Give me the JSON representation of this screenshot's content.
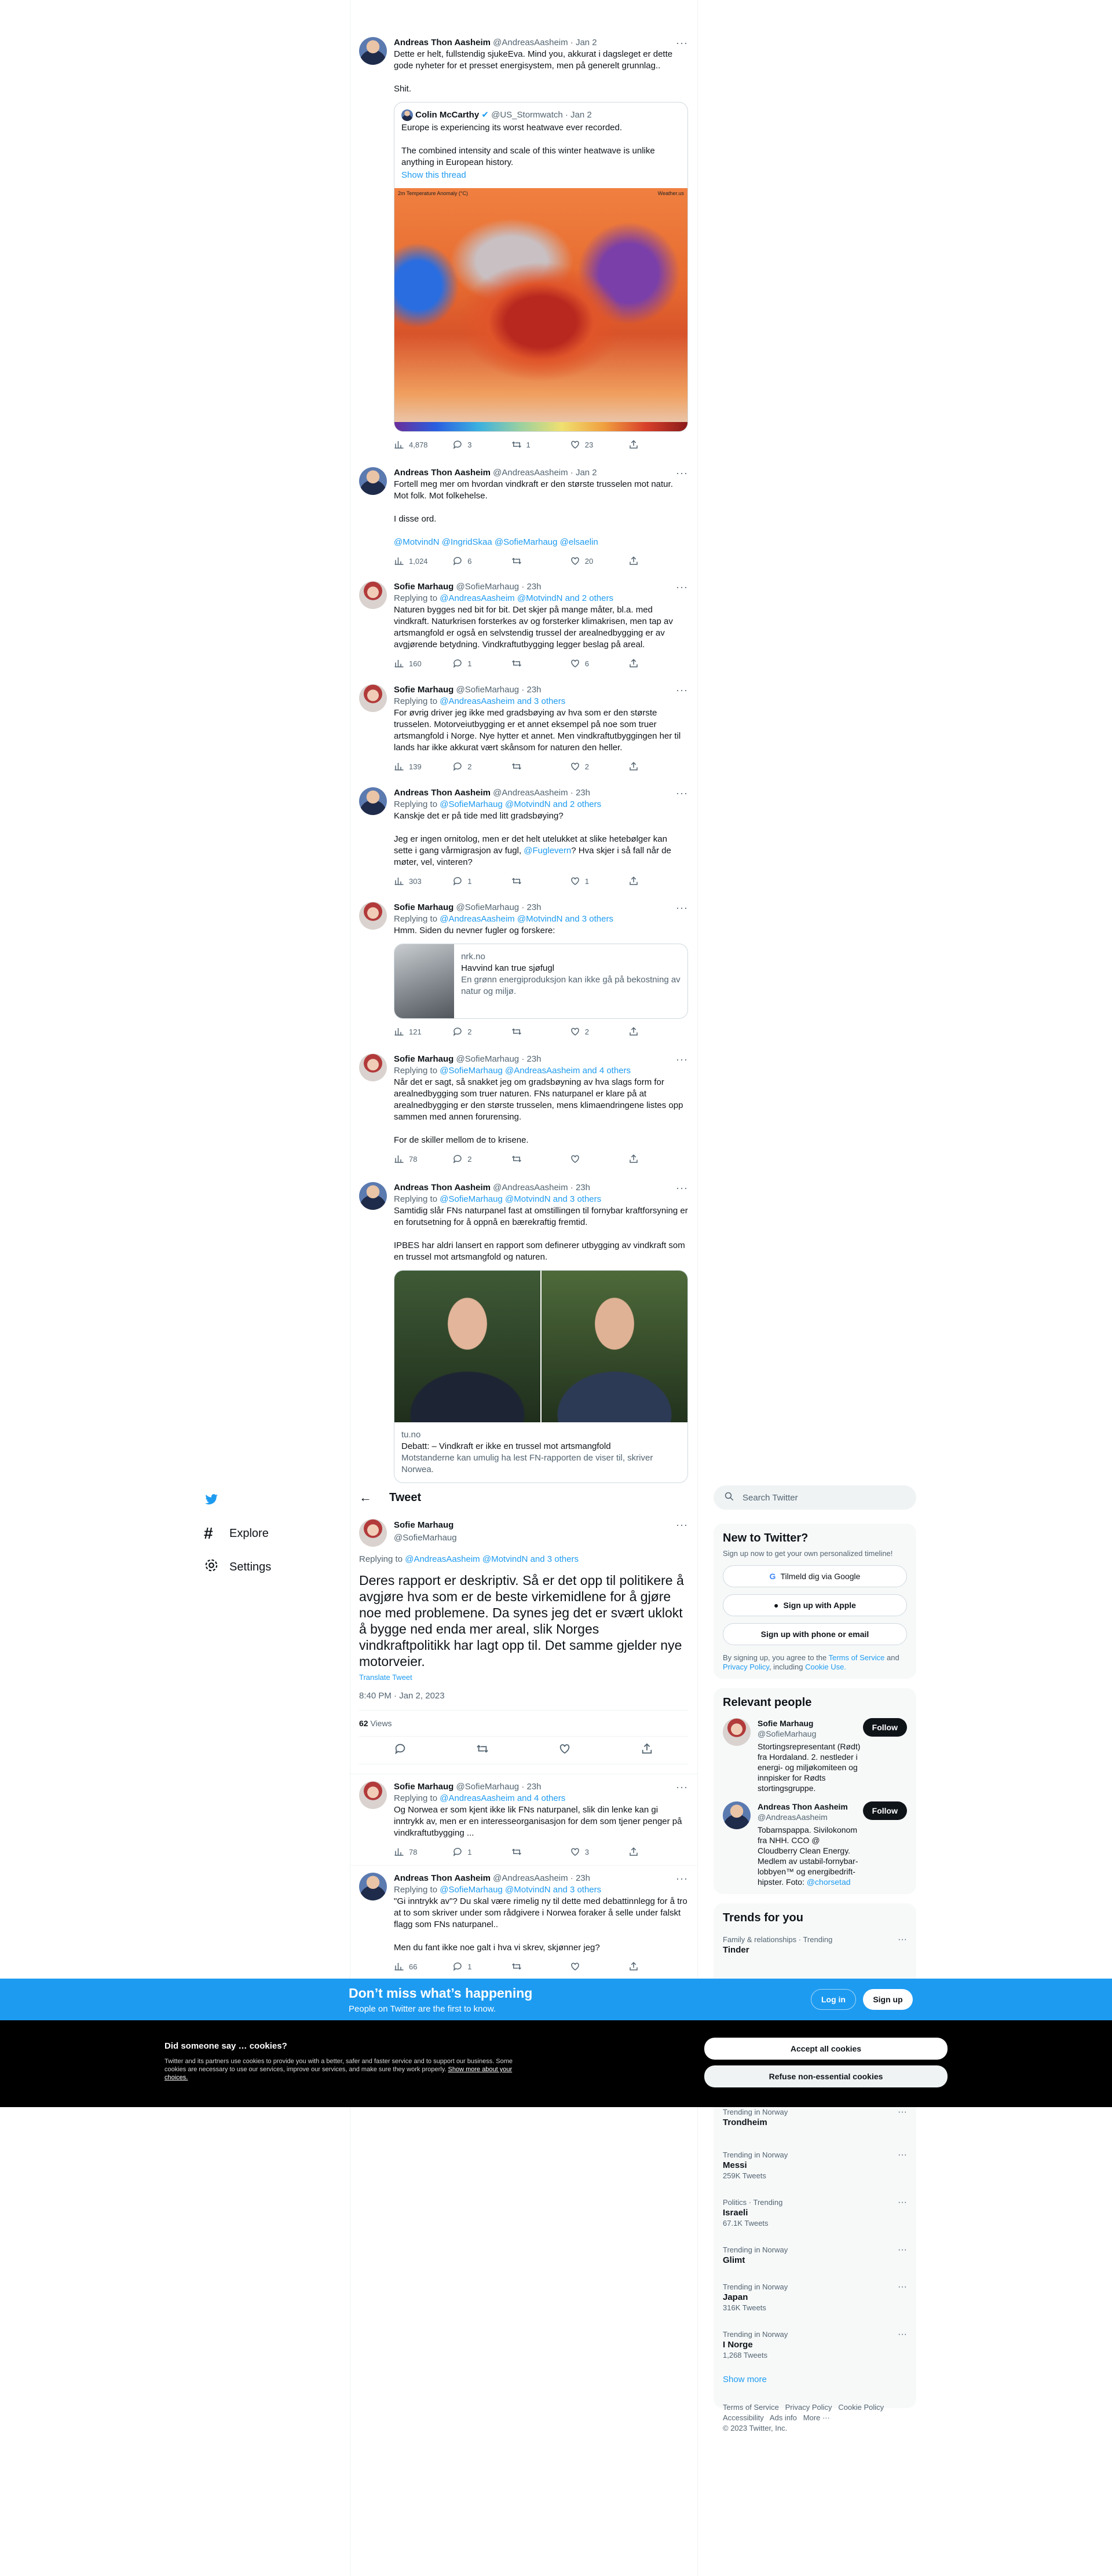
{
  "icons": {
    "reply": "reply-icon",
    "retweet": "retweet-icon",
    "like": "heart-icon",
    "share": "share-icon",
    "views": "views-icon",
    "more": "more-dots-icon"
  },
  "thread": [
    {
      "name": "Andreas Thon Aasheim",
      "handle": "@AndreasAasheim",
      "time": "· Jan 2",
      "text": "Dette er helt, fullstendig sjukeEva. Mind you, akkurat i dagsleget er dette gode nyheter for et presset energisystem, men på generelt grunnlag..\n\nShit.",
      "quote": {
        "name": "Colin McCarthy",
        "handle": "@US_Stormwatch · Jan 2",
        "text": "Europe is experiencing its worst heatwave ever recorded.\n\nThe combined intensity and scale of this winter heatwave is unlike anything in European history.",
        "show": "Show this thread",
        "map_title": "2m Temperature Anomaly (°C)",
        "map_right": "Weather.us"
      },
      "views": "4,878",
      "replies": "3",
      "retweets": "1",
      "likes": "23"
    },
    {
      "name": "Andreas Thon Aasheim",
      "handle": "@AndreasAasheim",
      "time": "· Jan 2",
      "text": "Fortell meg mer om hvordan vindkraft er den største trusselen mot natur. Mot folk. Mot folkehelse.\n\nI disse ord.",
      "links": "@MotvindN @IngridSkaa @SofieMarhaug @elsaelin",
      "views": "1,024",
      "replies": "6",
      "retweets": "",
      "likes": "20"
    },
    {
      "name": "Sofie Marhaug",
      "handle": "@SofieMarhaug",
      "time": "· 23h",
      "replying": "@AndreasAasheim @MotvindN and 2 others",
      "text": "Naturen bygges ned bit for bit. Det skjer på mange måter, bl.a. med vindkraft. Naturkrisen forsterkes av og forsterker klimakrisen, men tap av artsmangfold er også en selvstendig trussel der arealnedbygging er av avgjørende betydning. Vindkraftutbygging legger beslag på areal.",
      "views": "160",
      "replies": "1",
      "retweets": "",
      "likes": "6"
    },
    {
      "name": "Sofie Marhaug",
      "handle": "@SofieMarhaug",
      "time": "· 23h",
      "replying": "@AndreasAasheim and 3 others",
      "text": "For øvrig driver jeg ikke med gradsbøying av hva som er den største trusselen. Motorveiutbygging er et annet eksempel på noe som truer artsmangfold i Norge. Nye hytter et annet. Men vindkraftutbyggingen her til lands har ikke akkurat vært skånsom for naturen den heller.",
      "views": "139",
      "replies": "2",
      "retweets": "",
      "likes": "2"
    },
    {
      "name": "Andreas Thon Aasheim",
      "handle": "@AndreasAasheim",
      "time": "· 23h",
      "replying": "@SofieMarhaug @MotvindN and 2 others",
      "text": "Kanskje det er på tide med litt gradsbøying?\n\nJeg er ingen ornitolog, men er det helt utelukket at slike hetebølger kan sette i gang vårmigrasjon av fugl, ",
      "mention": "@Fuglevern",
      "text2": "? Hva skjer i så fall når de møter, vel, vinteren?",
      "views": "303",
      "replies": "1",
      "retweets": "",
      "likes": "1"
    },
    {
      "name": "Sofie Marhaug",
      "handle": "@SofieMarhaug",
      "time": "· 23h",
      "replying": "@AndreasAasheim @MotvindN and 3 others",
      "text": "Hmm. Siden du nevner fugler og forskere:",
      "card": {
        "domain": "nrk.no",
        "title": "Havvind kan true sjøfugl",
        "desc": "En grønn energiproduksjon kan ikke gå på bekostning av natur og miljø."
      },
      "views": "121",
      "replies": "2",
      "retweets": "",
      "likes": "2"
    },
    {
      "name": "Sofie Marhaug",
      "handle": "@SofieMarhaug",
      "time": "· 23h",
      "replying": "@SofieMarhaug @AndreasAasheim and 4 others",
      "text": "Når det er sagt, så snakket jeg om gradsbøyning av hva slags form for arealnedbygging som truer naturen. FNs naturpanel er klare på at arealnedbygging er den største trusselen, mens klimaendringene listes opp sammen med annen forurensing.\n\nFor de skiller mellom de to krisene.",
      "views": "78",
      "replies": "2",
      "retweets": "",
      "likes": ""
    },
    {
      "name": "Andreas Thon Aasheim",
      "handle": "@AndreasAasheim",
      "time": "· 23h",
      "replying": "@SofieMarhaug @MotvindN and 3 others",
      "text": "Samtidig slår FNs naturpanel fast at omstillingen til fornybar kraftforsyning er en forutsetning for å oppnå en bærekraftig fremtid.\n\nIPBES har aldri lansert en rapport som definerer utbygging av vindkraft som en trussel mot artsmangfold og naturen.",
      "photo": {
        "domain": "tu.no",
        "title": "Debatt: – Vindkraft er ikke en trussel mot artsmangfold",
        "desc": "Motstanderne kan umulig ha lest FN-rapporten de viser til, skriver Norwea."
      }
    }
  ],
  "nav": {
    "explore": "Explore",
    "settings": "Settings"
  },
  "main": {
    "header": "Tweet",
    "name": "Sofie Marhaug",
    "handle": "@SofieMarhaug",
    "replying_prefix": "Replying to ",
    "replying": "@AndreasAasheim @MotvindN and 3 others",
    "text": "Deres rapport er deskriptiv. Så er det opp til politikere å avgjøre hva som er de beste virkemidlene for å gjøre noe med problemene. Da synes jeg det er svært uklokt å bygge ned enda mer areal, slik Norges vindkraftpolitikk har lagt opp til. Det samme gjelder nye motorveier.",
    "translate": "Translate Tweet",
    "meta": "8:40 PM · Jan 2, 2023",
    "views": "62",
    "views_label": " Views"
  },
  "replies": [
    {
      "name": "Sofie Marhaug",
      "handle": "@SofieMarhaug",
      "time": "· 23h",
      "replying": "@AndreasAasheim and 4 others",
      "text": "Og Norwea er som kjent ikke lik FNs naturpanel, slik din lenke kan gi inntrykk av, men er en interesseorganisasjon for dem som tjener penger på vindkraftutbygging ...",
      "views": "78",
      "replies": "1",
      "retweets": "",
      "likes": "3"
    },
    {
      "name": "Andreas Thon Aasheim",
      "handle": "@AndreasAasheim",
      "time": "· 23h",
      "replying": "@SofieMarhaug @MotvindN and 3 others",
      "text": "\"Gi inntrykk av\"? Du skal være rimelig ny til dette med debattinnlegg for å tro at to som skriver under som rådgivere i Norwea foraker å selle under falskt flagg som FNs naturpanel..\n\nMen du fant ikke noe galt i hva vi skrev, skjønner jeg?",
      "views": "66",
      "replies": "1",
      "retweets": "",
      "likes": ""
    }
  ],
  "right": {
    "search": "Search Twitter",
    "new_title": "New to Twitter?",
    "new_sub": "Sign up now to get your own personalized timeline!",
    "google": "Tilmeld dig via Google",
    "apple": "Sign up with Apple",
    "phone": "Sign up with phone or email",
    "terms": "By signing up, you agree to the ",
    "terms_link": "Terms of Service",
    "and": " and ",
    "privacy": "Privacy Policy",
    "incl": ", including ",
    "cookie": "Cookie Use.",
    "relevant": "Relevant people",
    "people": [
      {
        "name": "Sofie Marhaug",
        "handle": "@SofieMarhaug",
        "follow": "Follow",
        "bio": "Stortingsrepresentant (Rødt) fra Hordaland. 2. nestleder i energi- og miljøkomiteen og innpisker for Rødts stortingsgruppe."
      },
      {
        "name": "Andreas Thon Aasheim",
        "handle": "@AndreasAasheim",
        "follow": "Follow",
        "bio": "Tobarnspappa. Sivilokonom fra NHH. CCO @ Cloudberry Clean Energy. Medlem av ustabil-fornybar-lobbyen™ og energibedrift-hipster. Foto: ",
        "biolink": "@chorsetad"
      }
    ],
    "trends_title": "Trends for you",
    "trend_top": {
      "cat": "Family & relationships · Trending",
      "name": "Tinder"
    },
    "trends": [
      {
        "cat": "Trending in Norway",
        "name": "Trondheim",
        "count": ""
      },
      {
        "cat": "Trending in Norway",
        "name": "Messi",
        "count": "259K Tweets"
      },
      {
        "cat": "Politics · Trending",
        "name": "Israeli",
        "count": "67.1K Tweets"
      },
      {
        "cat": "Trending in Norway",
        "name": "Glimt",
        "count": ""
      },
      {
        "cat": "Trending in Norway",
        "name": "Japan",
        "count": "316K Tweets"
      },
      {
        "cat": "Trending in Norway",
        "name": "I Norge",
        "count": "1,268 Tweets"
      }
    ],
    "show_more": "Show more",
    "footer1": "Terms of Service   Privacy Policy   Cookie Policy",
    "footer2": "Accessibility   Ads info   More ···",
    "footer3": "© 2023 Twitter, Inc."
  },
  "banner": {
    "title": "Don’t miss what’s happening",
    "sub": "People on Twitter are the first to know.",
    "login": "Log in",
    "signup": "Sign up"
  },
  "cookies": {
    "title": "Did someone say … cookies?",
    "text": "Twitter and its partners use cookies to provide you with a better, safer and faster service and to support our business. Some cookies are necessary to use our services, improve our services, and make sure they work properly. ",
    "link": "Show more about your choices.",
    "accept": "Accept all cookies",
    "refuse": "Refuse non-essential cookies"
  }
}
